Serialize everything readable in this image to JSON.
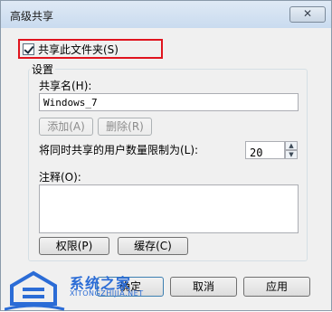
{
  "window": {
    "title": "高级共享",
    "close_label": "✕"
  },
  "share_checkbox": {
    "label": "共享此文件夹(S)",
    "checked": true
  },
  "settings": {
    "group_label": "设置",
    "share_name_label": "共享名(H):",
    "share_name_value": "Windows_7",
    "add_button": "添加(A)",
    "remove_button": "删除(R)",
    "limit_label": "将同时共享的用户数量限制为(L):",
    "limit_value": "20",
    "comment_label": "注释(O):",
    "comment_value": "",
    "permissions_button": "权限(P)",
    "caching_button": "缓存(C)"
  },
  "footer": {
    "ok_button": "确定",
    "cancel_button": "取消",
    "apply_button": "应用"
  },
  "watermark": {
    "title": "系统之家",
    "subtitle": "XITONGZHIJIA.NET"
  },
  "colors": {
    "highlight_border": "#e0141e",
    "watermark_blue": "#2b6cd6"
  },
  "icons": {
    "close": "close-icon",
    "spin_up": "chevron-up-icon",
    "spin_down": "chevron-down-icon",
    "watermark_logo": "house-logo-icon"
  }
}
